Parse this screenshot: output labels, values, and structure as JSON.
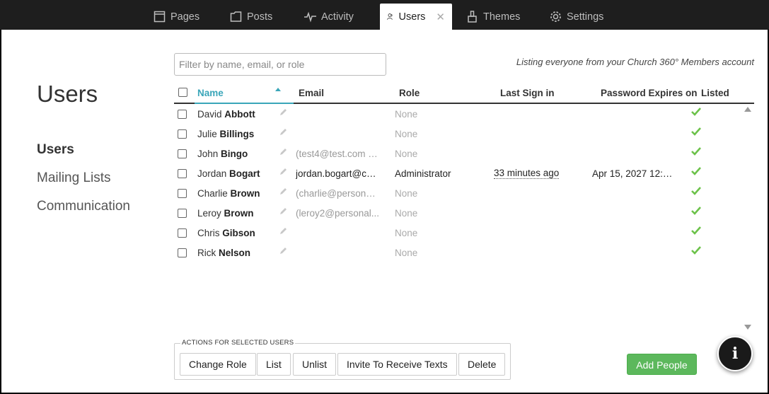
{
  "tabs": [
    {
      "label": "Pages",
      "icon": "page-icon"
    },
    {
      "label": "Posts",
      "icon": "folder-icon"
    },
    {
      "label": "Activity",
      "icon": "activity-icon"
    },
    {
      "label": "Users",
      "icon": "users-icon",
      "active": true
    },
    {
      "label": "Themes",
      "icon": "brush-icon"
    },
    {
      "label": "Settings",
      "icon": "gear-icon"
    }
  ],
  "page_title": "Users",
  "nav": [
    "Users",
    "Mailing Lists",
    "Communication"
  ],
  "filter": {
    "placeholder": "Filter by name, email, or role"
  },
  "listing_note": "Listing everyone from your Church 360° Members account",
  "table": {
    "headers": {
      "name": "Name",
      "email": "Email",
      "role": "Role",
      "last_sign_in": "Last Sign in",
      "password_expires": "Password Expires on",
      "listed": "Listed"
    },
    "rows": [
      {
        "first": "David",
        "last": "Abbott",
        "email": "",
        "role": "None",
        "last_sign_in": "",
        "password_expires": ""
      },
      {
        "first": "Julie",
        "last": "Billings",
        "email": "",
        "role": "None",
        "last_sign_in": "",
        "password_expires": ""
      },
      {
        "first": "John",
        "last": "Bingo",
        "email": "(test4@test.com o...",
        "role": "None",
        "last_sign_in": "",
        "password_expires": ""
      },
      {
        "first": "Jordan",
        "last": "Bogart",
        "email": "jordan.bogart@cp...",
        "role": "Administrator",
        "last_sign_in": "33 minutes ago",
        "password_expires": "Apr 15, 2027 12:5..."
      },
      {
        "first": "Charlie",
        "last": "Brown",
        "email": "(charlie@personal...",
        "role": "None",
        "last_sign_in": "",
        "password_expires": ""
      },
      {
        "first": "Leroy",
        "last": "Brown",
        "email": "(leroy2@personal...",
        "role": "None",
        "last_sign_in": "",
        "password_expires": ""
      },
      {
        "first": "Chris",
        "last": "Gibson",
        "email": "",
        "role": "None",
        "last_sign_in": "",
        "password_expires": ""
      },
      {
        "first": "Rick",
        "last": "Nelson",
        "email": "",
        "role": "None",
        "last_sign_in": "",
        "password_expires": ""
      }
    ]
  },
  "actions": {
    "label": "ACTIONS FOR SELECTED USERS",
    "change_role": "Change Role",
    "list": "List",
    "unlist": "Unlist",
    "invite": "Invite To Receive Texts",
    "delete": "Delete"
  },
  "add_people": "Add People",
  "info_label": "i",
  "colors": {
    "accent": "#3aa6b9",
    "success": "#5cb85c",
    "check": "#6cc24a"
  }
}
